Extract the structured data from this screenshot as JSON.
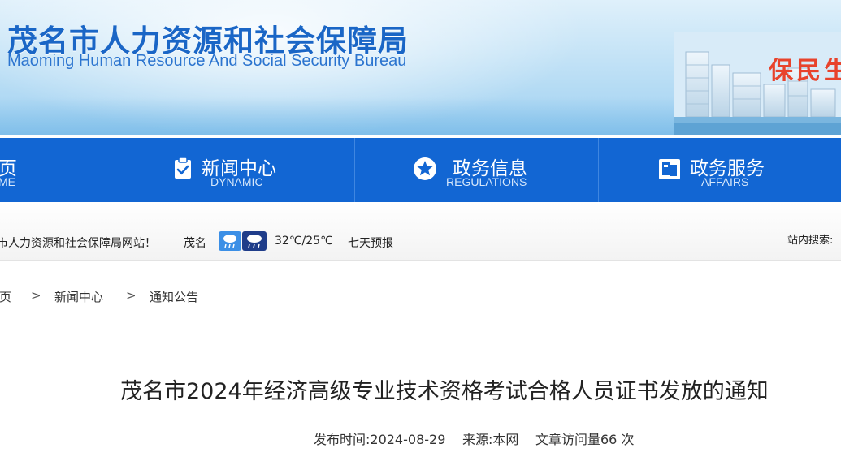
{
  "banner": {
    "title_cn": "茂名市人力资源和社会保障局",
    "title_en": "Maoming Human Resource And Social Security Bureau",
    "slogan": "保民生"
  },
  "nav": {
    "items": [
      {
        "cn": "页",
        "en": "ME",
        "icon": ""
      },
      {
        "cn": "新闻中心",
        "en": "DYNAMIC",
        "icon": "clipboard-check-icon"
      },
      {
        "cn": "政务信息",
        "en": "REGULATIONS",
        "icon": "star-circle-icon"
      },
      {
        "cn": "政务服务",
        "en": "AFFAIRS",
        "icon": "service-folder-icon"
      }
    ]
  },
  "infobar": {
    "welcome": "市人力资源和社会保障局网站！",
    "city": "茂名",
    "weather_icons": [
      "light-rain-icon",
      "thunderstorm-icon"
    ],
    "temperature": "32℃/25℃",
    "forecast_link": "七天预报",
    "search_label": "站内搜索:"
  },
  "breadcrumb": {
    "items": [
      "页",
      "新闻中心",
      "通知公告"
    ],
    "separator": ">"
  },
  "article": {
    "title": "茂名市2024年经济高级专业技术资格考试合格人员证书发放的通知",
    "publish_time": "发布时间:2024-08-29",
    "source": "来源:本网",
    "visits": "文章访问量66 次"
  },
  "colors": {
    "nav_blue": "#1266d3",
    "title_blue": "#1a66c6",
    "slogan_red": "#e8432c"
  }
}
